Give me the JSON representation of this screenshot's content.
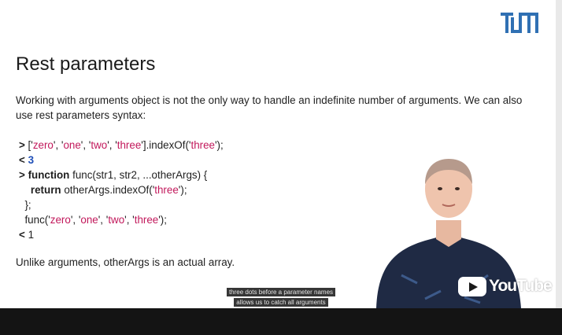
{
  "slide": {
    "title": "Rest parameters",
    "intro": "Working with arguments object is not the only way to handle an indefinite number of arguments. We can also use rest parameters syntax:",
    "outro": "Unlike arguments, otherArgs is an actual array.",
    "code": {
      "l1_prompt": ">",
      "l1_a": " ['",
      "l1_s1": "zero",
      "l1_b": "', '",
      "l1_s2": "one",
      "l1_c": "', '",
      "l1_s3": "two",
      "l1_d": "', '",
      "l1_s4": "three",
      "l1_e": "'].indexOf('",
      "l1_s5": "three",
      "l1_f": "');",
      "l2_prompt": "<",
      "l2_value": "3",
      "l3_prompt": ">",
      "l3_kw": "function",
      "l3_rest": " func(str1, str2, ...otherArgs) {",
      "l4_kw": "return",
      "l4_a": " otherArgs.indexOf('",
      "l4_s": "three",
      "l4_b": "');",
      "l5": "};",
      "l6_a": "func('",
      "l6_s1": "zero",
      "l6_b": "', '",
      "l6_s2": "one",
      "l6_c": "', '",
      "l6_s3": "two",
      "l6_d": "', '",
      "l6_s4": "three",
      "l6_e": "');",
      "l7_prompt": "<",
      "l7_value": "1"
    }
  },
  "captions": {
    "line1": "three dots before a parameter names",
    "line2": "allows us to catch all arguments"
  },
  "branding": {
    "channel_logo": "TUM",
    "player_logo": "YouTube"
  },
  "colors": {
    "tum_blue": "#3070b3",
    "string_red": "#c2185b",
    "number_blue": "#1f4fb8",
    "bar": "#141414"
  },
  "icons": {
    "play": "youtube-play-icon"
  }
}
